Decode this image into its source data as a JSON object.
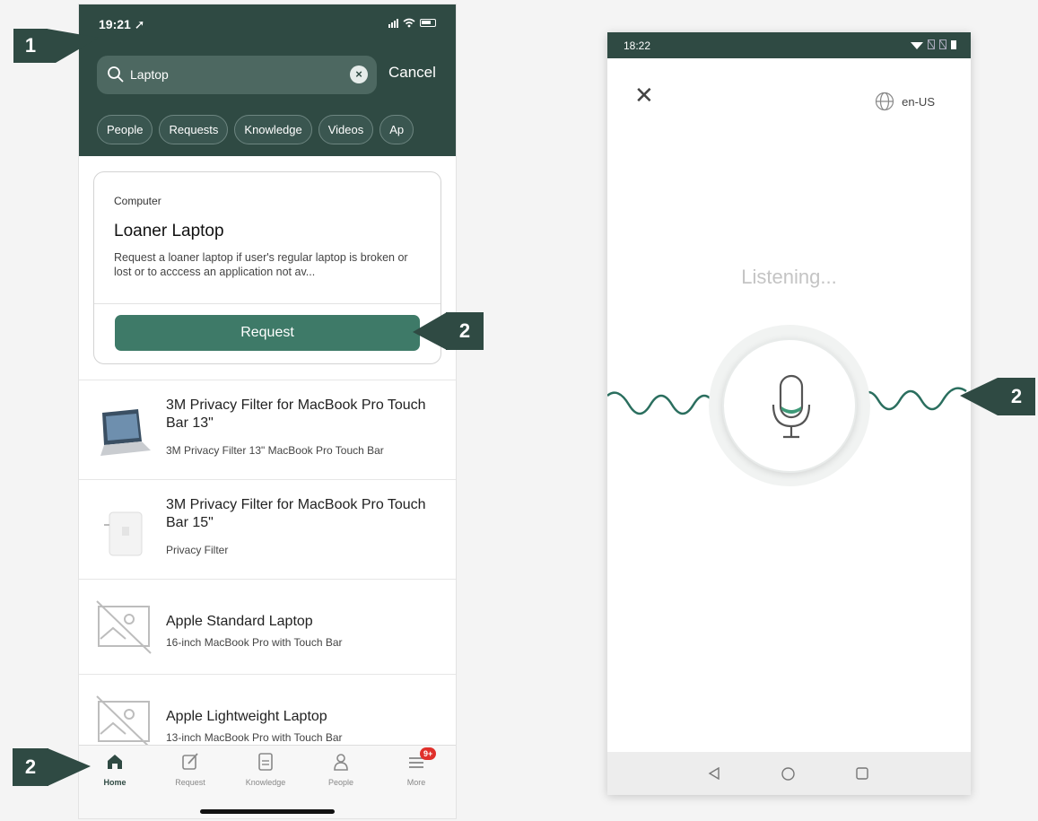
{
  "left_phone": {
    "status_time": "19:21",
    "search": {
      "value": "Laptop",
      "cancel_label": "Cancel"
    },
    "filters": [
      "People",
      "Requests",
      "Knowledge",
      "Videos",
      "Ap"
    ],
    "card": {
      "category": "Computer",
      "title": "Loaner Laptop",
      "description": "Request a loaner laptop if user's regular laptop is broken or lost or to acccess an application not av...",
      "button_label": "Request"
    },
    "results": [
      {
        "title": "3M Privacy Filter for MacBook Pro Touch Bar 13\"",
        "subtitle": "3M Privacy Filter 13\" MacBook Pro Touch Bar",
        "thumb": "laptop-screen-thumbnail"
      },
      {
        "title": "3M Privacy Filter for MacBook Pro Touch Bar 15\"",
        "subtitle": "Privacy Filter",
        "thumb": "charger-thumbnail"
      },
      {
        "title": "Apple Standard Laptop",
        "subtitle": "16-inch MacBook Pro with Touch Bar",
        "thumb": "image-placeholder-icon"
      },
      {
        "title": "Apple Lightweight Laptop",
        "subtitle": "13-inch MacBook Pro with Touch Bar",
        "thumb": "image-placeholder-icon"
      }
    ],
    "tabs": [
      {
        "label": "Home",
        "icon": "home-icon",
        "active": true
      },
      {
        "label": "Request",
        "icon": "edit-icon"
      },
      {
        "label": "Knowledge",
        "icon": "document-icon"
      },
      {
        "label": "People",
        "icon": "person-icon"
      },
      {
        "label": "More",
        "icon": "menu-icon",
        "badge": "9+"
      }
    ]
  },
  "right_phone": {
    "status_time": "18:22",
    "language": "en-US",
    "listening_text": "Listening..."
  },
  "callouts": {
    "search_callout": "1",
    "request_callout": "2",
    "tabbar_callout": "2",
    "mic_callout": "2"
  },
  "colors": {
    "header_green": "#2f4a43",
    "accent_green": "#3e7a68",
    "badge_red": "#e0302b"
  }
}
